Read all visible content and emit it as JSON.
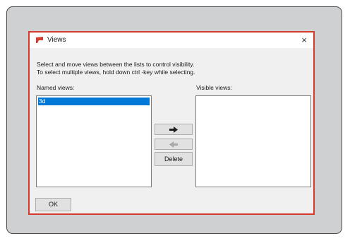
{
  "dialog": {
    "title": "Views",
    "close_glyph": "×",
    "instructions_line1": "Select and move views between the lists to control visibility.",
    "instructions_line2": "To select multiple views, hold down ctrl -key while selecting.",
    "named_label": "Named views:",
    "visible_label": "Visible views:",
    "named_views": [
      "3d"
    ],
    "visible_views": [],
    "move_right_icon": "arrow-right-icon",
    "move_left_icon": "arrow-left-icon",
    "delete_label": "Delete",
    "ok_label": "OK"
  },
  "colors": {
    "accent_border": "#d43b2c",
    "selection": "#0078d7"
  }
}
